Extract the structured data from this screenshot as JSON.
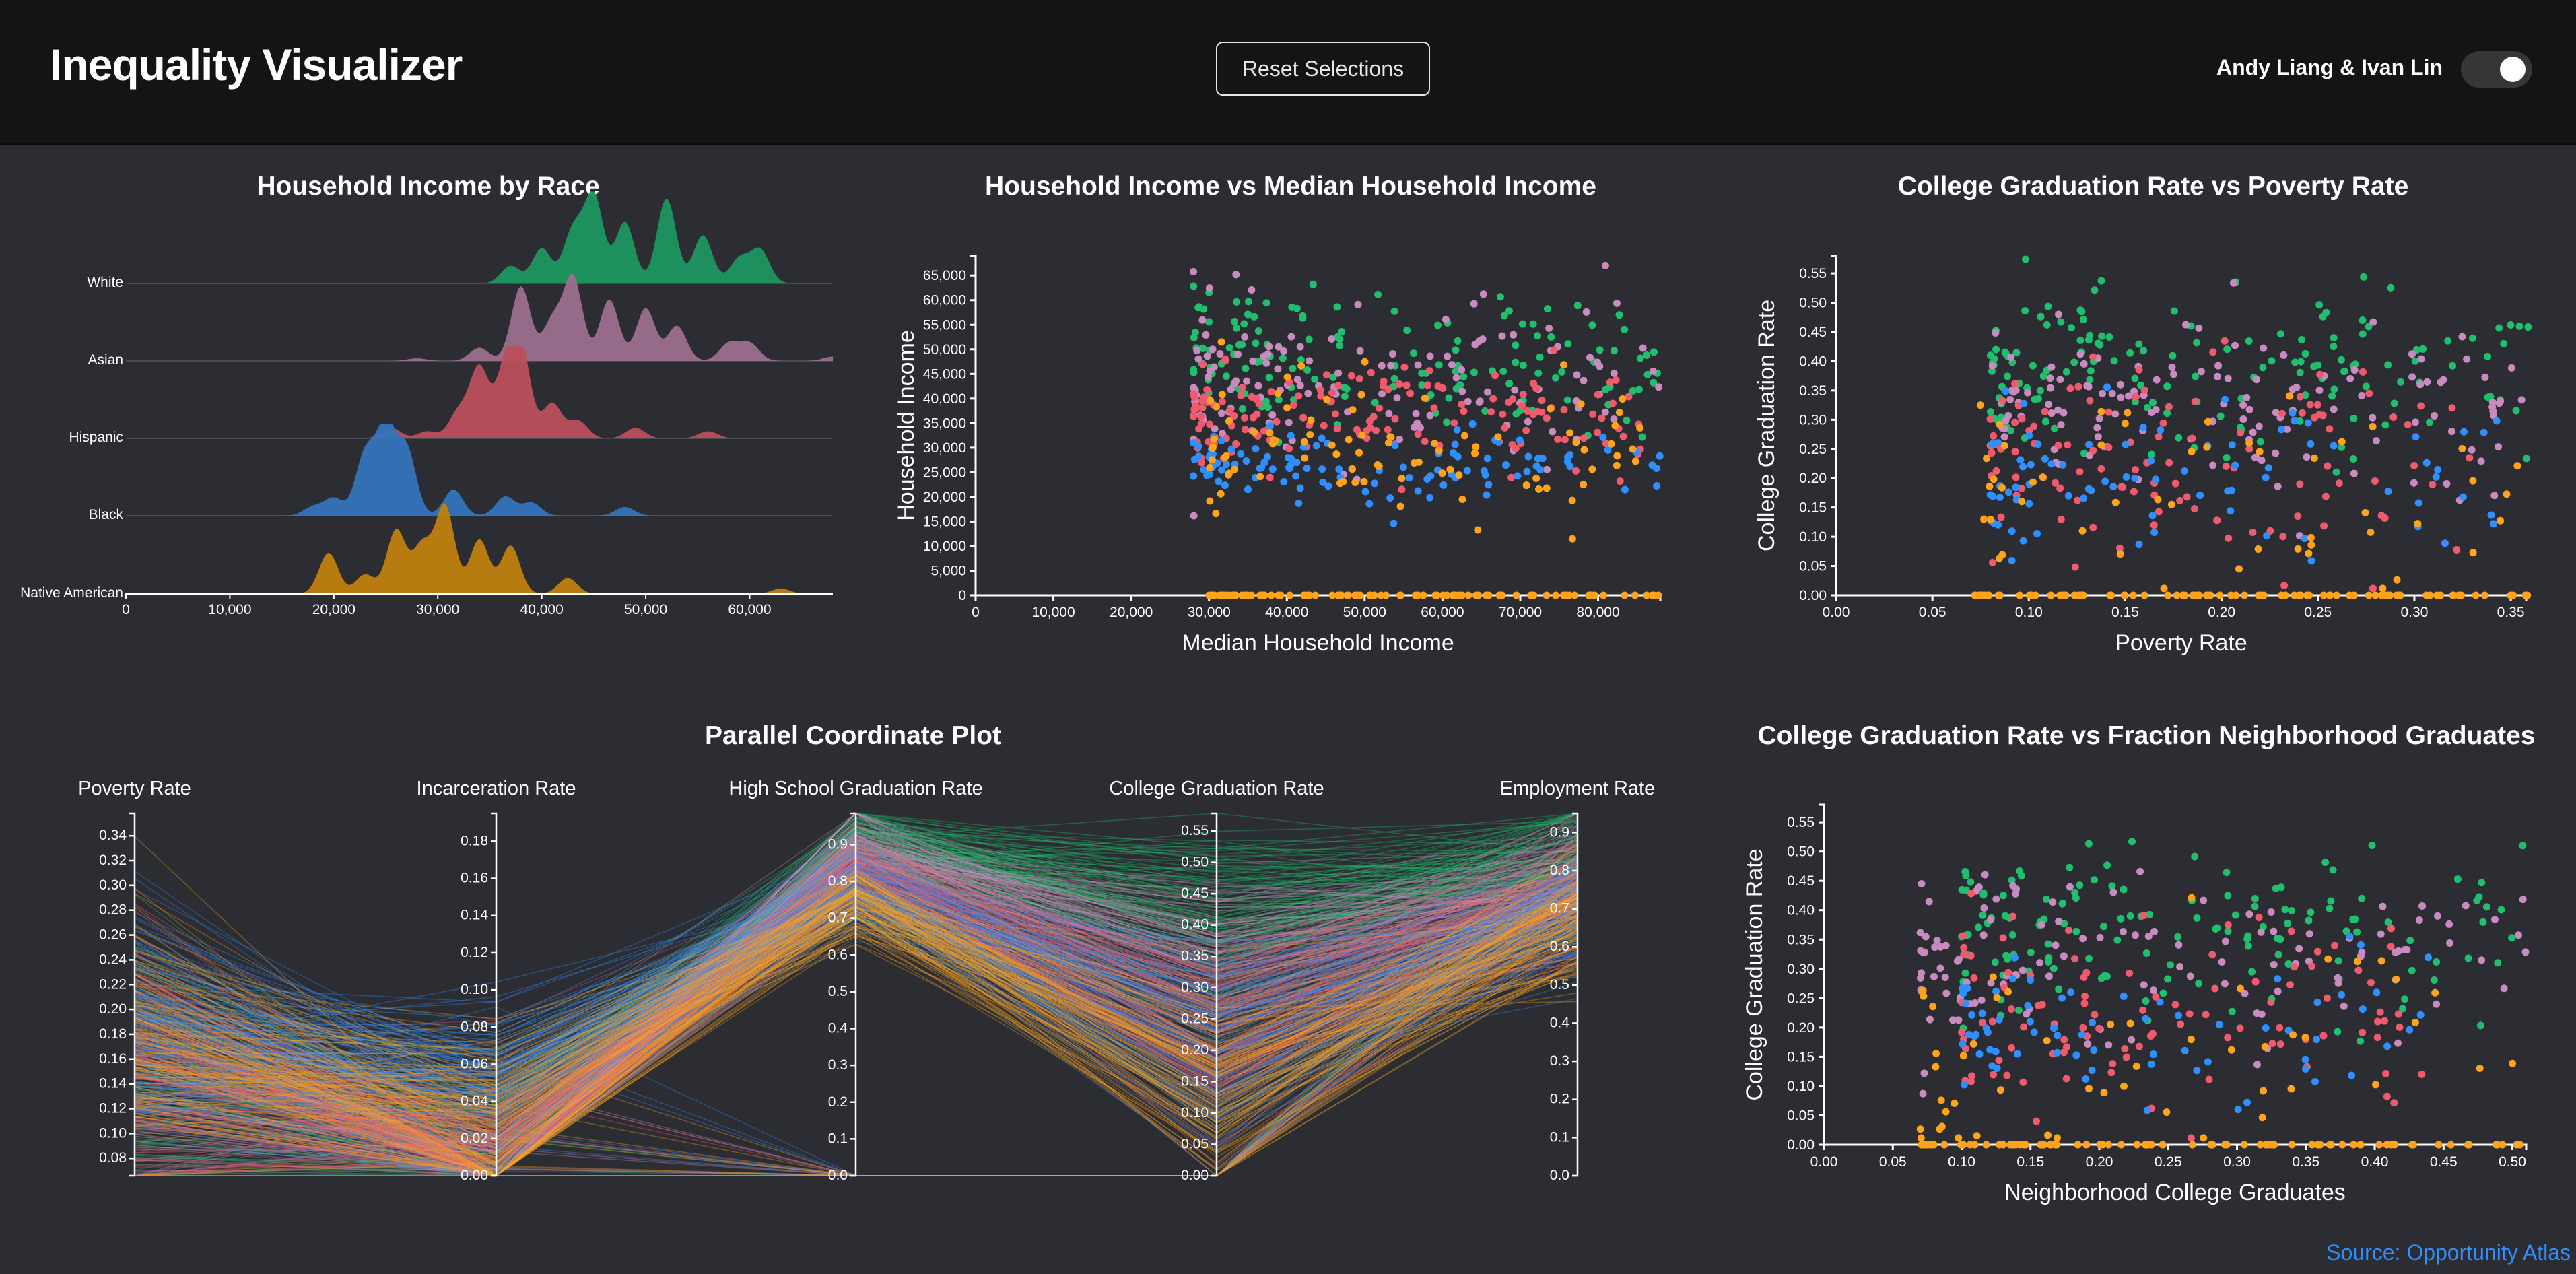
{
  "header": {
    "title": "Inequality Visualizer",
    "reset_label": "Reset Selections",
    "authors": "Andy Liang & Ivan Lin",
    "toggle_on": true
  },
  "colors": {
    "White": "#1fbf6e",
    "Asian": "#c98bbf",
    "Hispanic": "#f05a6c",
    "Black": "#2f8fff",
    "Native American": "#ffa31a"
  },
  "ridge_colors": {
    "White": "#1e9660",
    "Asian": "#9c6f8e",
    "Hispanic": "#b94f5c",
    "Black": "#3474bb",
    "Native American": "#bf800f"
  },
  "source_label": "Source: Opportunity Atlas",
  "chart_data": [
    {
      "id": "ridgeline",
      "type": "area",
      "title": "Household Income by Race",
      "categories": [
        "White",
        "Asian",
        "Hispanic",
        "Black",
        "Native American"
      ],
      "xlim": [
        0,
        68000
      ],
      "xticks": [
        "0",
        "10,000",
        "20,000",
        "30,000",
        "40,000",
        "50,000",
        "60,000"
      ],
      "xtick_values": [
        0,
        10000,
        20000,
        30000,
        40000,
        50000,
        60000
      ],
      "density_peaks": {
        "White": [
          [
            37000,
            0.2
          ],
          [
            40000,
            0.4
          ],
          [
            43000,
            0.6
          ],
          [
            45000,
            1.0
          ],
          [
            48000,
            0.7
          ],
          [
            52000,
            0.97
          ],
          [
            55500,
            0.55
          ],
          [
            59000,
            0.28
          ],
          [
            61000,
            0.38
          ]
        ],
        "Asian": [
          [
            28000,
            0.03
          ],
          [
            34000,
            0.15
          ],
          [
            38000,
            0.85
          ],
          [
            41000,
            0.45
          ],
          [
            43000,
            0.95
          ],
          [
            46500,
            0.7
          ],
          [
            50000,
            0.6
          ],
          [
            53000,
            0.4
          ],
          [
            58000,
            0.2
          ],
          [
            60000,
            0.2
          ],
          [
            68000,
            0.05
          ]
        ],
        "Hispanic": [
          [
            25500,
            0.12
          ],
          [
            29000,
            0.08
          ],
          [
            32000,
            0.3
          ],
          [
            34000,
            0.8
          ],
          [
            36500,
            0.75
          ],
          [
            38000,
            1.0
          ],
          [
            41000,
            0.4
          ],
          [
            43500,
            0.2
          ],
          [
            49000,
            0.12
          ],
          [
            56000,
            0.08
          ]
        ],
        "Black": [
          [
            18000,
            0.1
          ],
          [
            20000,
            0.2
          ],
          [
            23000,
            0.7
          ],
          [
            25000,
            1.0
          ],
          [
            27000,
            0.75
          ],
          [
            31500,
            0.3
          ],
          [
            36500,
            0.22
          ],
          [
            39000,
            0.15
          ],
          [
            48000,
            0.1
          ]
        ],
        "Native American": [
          [
            19500,
            0.47
          ],
          [
            23000,
            0.22
          ],
          [
            26000,
            0.73
          ],
          [
            28500,
            0.55
          ],
          [
            30700,
            1.0
          ],
          [
            34000,
            0.62
          ],
          [
            37000,
            0.55
          ],
          [
            42500,
            0.18
          ],
          [
            63000,
            0.06
          ]
        ]
      }
    },
    {
      "id": "scatter_income",
      "type": "scatter",
      "title": "Household Income vs Median Household Income",
      "xlabel": "Median Household Income",
      "ylabel": "Household Income",
      "xlim": [
        0,
        88000
      ],
      "ylim": [
        0,
        69000
      ],
      "xticks": [
        "0",
        "10,000",
        "20,000",
        "30,000",
        "40,000",
        "50,000",
        "60,000",
        "70,000",
        "80,000"
      ],
      "xtick_values": [
        0,
        10000,
        20000,
        30000,
        40000,
        50000,
        60000,
        70000,
        80000
      ],
      "yticks": [
        "0",
        "5,000",
        "10,000",
        "15,000",
        "20,000",
        "25,000",
        "30,000",
        "35,000",
        "40,000",
        "45,000",
        "50,000",
        "55,000",
        "60,000",
        "65,000"
      ],
      "ytick_values": [
        0,
        5000,
        10000,
        15000,
        20000,
        25000,
        30000,
        35000,
        40000,
        45000,
        50000,
        55000,
        60000,
        65000
      ],
      "series_summary": {
        "White": {
          "x_range": [
            28000,
            88000
          ],
          "y_center": 48000,
          "y_spread": 7000
        },
        "Asian": {
          "x_range": [
            28000,
            88000
          ],
          "y_center": 44000,
          "y_spread": 8000
        },
        "Hispanic": {
          "x_range": [
            28000,
            88000
          ],
          "y_center": 36000,
          "y_spread": 5000
        },
        "Native American": {
          "x_range": [
            30000,
            88000
          ],
          "y_center": 30000,
          "y_spread": 7000,
          "zero_values": true
        },
        "Black": {
          "x_range": [
            28000,
            88000
          ],
          "y_center": 26000,
          "y_spread": 4000
        }
      }
    },
    {
      "id": "scatter_poverty",
      "type": "scatter",
      "title": "College Graduation Rate vs Poverty Rate",
      "xlabel": "Poverty Rate",
      "ylabel": "College Graduation Rate",
      "xlim": [
        0,
        0.358
      ],
      "ylim": [
        0,
        0.58
      ],
      "xticks": [
        "0.00",
        "0.05",
        "0.10",
        "0.15",
        "0.20",
        "0.25",
        "0.30",
        "0.35"
      ],
      "xtick_values": [
        0,
        0.05,
        0.1,
        0.15,
        0.2,
        0.25,
        0.3,
        0.35
      ],
      "yticks": [
        "0.00",
        "0.05",
        "0.10",
        "0.15",
        "0.20",
        "0.25",
        "0.30",
        "0.35",
        "0.40",
        "0.45",
        "0.50",
        "0.55"
      ],
      "ytick_values": [
        0,
        0.05,
        0.1,
        0.15,
        0.2,
        0.25,
        0.3,
        0.35,
        0.4,
        0.45,
        0.5,
        0.55
      ],
      "series_summary": {
        "White": {
          "x_range": [
            0.08,
            0.36
          ],
          "y_center": 0.38,
          "y_spread": 0.07
        },
        "Asian": {
          "x_range": [
            0.08,
            0.36
          ],
          "y_center": 0.33,
          "y_spread": 0.08
        },
        "Hispanic": {
          "x_range": [
            0.08,
            0.33
          ],
          "y_center": 0.22,
          "y_spread": 0.09
        },
        "Native American": {
          "x_range": [
            0.07,
            0.36
          ],
          "y_center": 0.15,
          "y_spread": 0.1,
          "zero_values": true
        },
        "Black": {
          "x_range": [
            0.08,
            0.36
          ],
          "y_center": 0.2,
          "y_spread": 0.07
        }
      }
    },
    {
      "id": "parallel",
      "type": "line",
      "title": "Parallel Coordinate Plot",
      "axes": [
        {
          "label": "Poverty Rate",
          "domain": [
            0.066,
            0.358
          ],
          "ticks": [
            "0.08",
            "0.10",
            "0.12",
            "0.14",
            "0.16",
            "0.18",
            "0.20",
            "0.22",
            "0.24",
            "0.26",
            "0.28",
            "0.30",
            "0.32",
            "0.34"
          ],
          "tick_values": [
            0.08,
            0.1,
            0.12,
            0.14,
            0.16,
            0.18,
            0.2,
            0.22,
            0.24,
            0.26,
            0.28,
            0.3,
            0.32,
            0.34
          ]
        },
        {
          "label": "Incarceration Rate",
          "domain": [
            0,
            0.195
          ],
          "ticks": [
            "0.00",
            "0.02",
            "0.04",
            "0.06",
            "0.08",
            "0.10",
            "0.12",
            "0.14",
            "0.16",
            "0.18"
          ],
          "tick_values": [
            0,
            0.02,
            0.04,
            0.06,
            0.08,
            0.1,
            0.12,
            0.14,
            0.16,
            0.18
          ]
        },
        {
          "label": "High School Graduation Rate",
          "domain": [
            0,
            0.985
          ],
          "ticks": [
            "0.0",
            "0.1",
            "0.2",
            "0.3",
            "0.4",
            "0.5",
            "0.6",
            "0.7",
            "0.8",
            "0.9"
          ],
          "tick_values": [
            0,
            0.1,
            0.2,
            0.3,
            0.4,
            0.5,
            0.6,
            0.7,
            0.8,
            0.9
          ]
        },
        {
          "label": "College Graduation Rate",
          "domain": [
            0,
            0.578
          ],
          "ticks": [
            "0.00",
            "0.05",
            "0.10",
            "0.15",
            "0.20",
            "0.25",
            "0.30",
            "0.35",
            "0.40",
            "0.45",
            "0.50",
            "0.55"
          ],
          "tick_values": [
            0,
            0.05,
            0.1,
            0.15,
            0.2,
            0.25,
            0.3,
            0.35,
            0.4,
            0.45,
            0.5,
            0.55
          ]
        },
        {
          "label": "Employment Rate",
          "domain": [
            0,
            0.95
          ],
          "ticks": [
            "0.0",
            "0.1",
            "0.2",
            "0.3",
            "0.4",
            "0.5",
            "0.6",
            "0.7",
            "0.8",
            "0.9"
          ],
          "tick_values": [
            0,
            0.1,
            0.2,
            0.3,
            0.4,
            0.5,
            0.6,
            0.7,
            0.8,
            0.9
          ]
        }
      ]
    },
    {
      "id": "scatter_neighborhood",
      "type": "scatter",
      "title": "College Graduation Rate vs Fraction Neighborhood Graduates",
      "xlabel": "Neighborhood College Graduates",
      "ylabel": "College Graduation Rate",
      "xlim": [
        0,
        0.51
      ],
      "ylim": [
        0,
        0.58
      ],
      "xticks": [
        "0.00",
        "0.05",
        "0.10",
        "0.15",
        "0.20",
        "0.25",
        "0.30",
        "0.35",
        "0.40",
        "0.45",
        "0.50"
      ],
      "xtick_values": [
        0,
        0.05,
        0.1,
        0.15,
        0.2,
        0.25,
        0.3,
        0.35,
        0.4,
        0.45,
        0.5
      ],
      "yticks": [
        "0.00",
        "0.05",
        "0.10",
        "0.15",
        "0.20",
        "0.25",
        "0.30",
        "0.35",
        "0.40",
        "0.45",
        "0.50",
        "0.55"
      ],
      "ytick_values": [
        0,
        0.05,
        0.1,
        0.15,
        0.2,
        0.25,
        0.3,
        0.35,
        0.4,
        0.45,
        0.5,
        0.55
      ],
      "series_summary": {
        "White": {
          "x_range": [
            0.1,
            0.51
          ],
          "y_center": 0.36,
          "y_spread": 0.07
        },
        "Asian": {
          "x_range": [
            0.07,
            0.51
          ],
          "y_center": 0.32,
          "y_spread": 0.07
        },
        "Hispanic": {
          "x_range": [
            0.1,
            0.44
          ],
          "y_center": 0.22,
          "y_spread": 0.09
        },
        "Native American": {
          "x_range": [
            0.07,
            0.51
          ],
          "y_center": 0.15,
          "y_spread": 0.1,
          "zero_values": true
        },
        "Black": {
          "x_range": [
            0.1,
            0.44
          ],
          "y_center": 0.2,
          "y_spread": 0.06
        }
      }
    }
  ]
}
